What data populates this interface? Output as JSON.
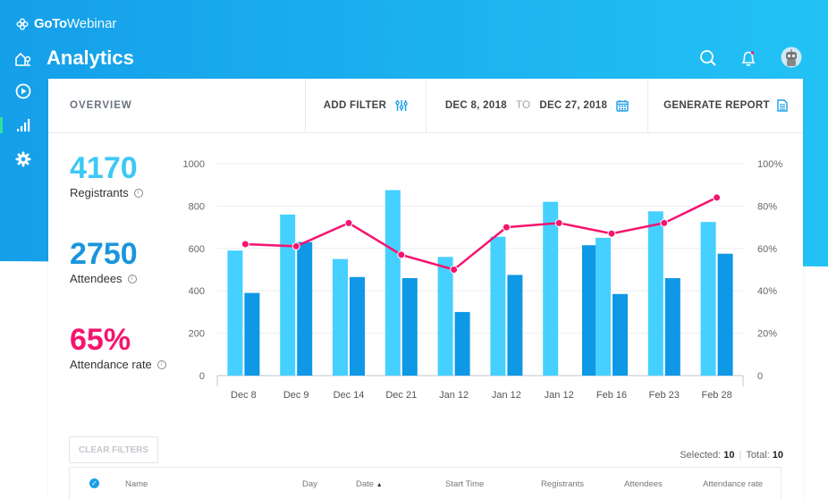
{
  "app": {
    "brand_bold": "GoTo",
    "brand_light": "Webinar",
    "page_title": "Analytics"
  },
  "sidebar": {
    "items": [
      {
        "name": "home",
        "icon": "home-icon",
        "active": false
      },
      {
        "name": "webinars",
        "icon": "play-circle-icon",
        "active": false
      },
      {
        "name": "analytics",
        "icon": "bar-signal-icon",
        "active": true
      },
      {
        "name": "settings",
        "icon": "gear-icon",
        "active": false
      }
    ]
  },
  "header_icons": [
    "search-icon",
    "bell-icon",
    "avatar-robot-icon"
  ],
  "toolbar": {
    "overview_label": "OVERVIEW",
    "add_filter_label": "ADD FILTER",
    "date_from": "DEC 8, 2018",
    "date_to_label": "TO",
    "date_to": "DEC 27, 2018",
    "generate_report_label": "GENERATE REPORT"
  },
  "stats": {
    "registrants": {
      "value": "4170",
      "label": "Registrants",
      "color": "#3dc8f7"
    },
    "attendees": {
      "value": "2750",
      "label": "Attendees",
      "color": "#1a95dc"
    },
    "rate": {
      "value": "65%",
      "label": "Attendance rate",
      "color": "#f5146e"
    }
  },
  "colors": {
    "header_blue": "#17a5ee",
    "registrants": "#45d0ff",
    "attendees": "#0e98e5",
    "rate_line": "#f5146e"
  },
  "chart_data": {
    "type": "bar",
    "title": "",
    "xlabel": "",
    "ylabel": "",
    "categories": [
      "Dec 8",
      "Dec 9",
      "Dec 14",
      "Dec 21",
      "Jan 12",
      "Jan 12",
      "Jan 12",
      "Feb 16",
      "Feb 23",
      "Feb 28"
    ],
    "ylim": [
      0,
      1000
    ],
    "y_ticks": [
      "0",
      "200",
      "400",
      "600",
      "800",
      "1000"
    ],
    "y2lim": [
      0,
      100
    ],
    "y2_ticks": [
      "0",
      "20%",
      "40%",
      "60%",
      "80%",
      "100%"
    ],
    "grid": true,
    "series": [
      {
        "name": "Registrants",
        "type": "bar",
        "values": [
          590,
          760,
          550,
          875,
          560,
          655,
          820,
          650,
          775,
          725
        ]
      },
      {
        "name": "Attendees",
        "type": "bar",
        "values": [
          390,
          630,
          465,
          460,
          300,
          475,
          615,
          385,
          460,
          575
        ]
      },
      {
        "name": "Attendance rate",
        "type": "line",
        "axis": "right",
        "values": [
          62,
          61,
          72,
          57,
          50,
          70,
          72,
          67,
          72,
          84
        ]
      }
    ]
  },
  "table": {
    "clear_filters_label": "CLEAR FILTERS",
    "selected_label": "Selected:",
    "selected_value": "10",
    "total_label": "Total:",
    "total_value": "10",
    "columns": [
      "Name",
      "Day",
      "Date",
      "Start Time",
      "Registrants",
      "Attendees",
      "Attendance rate"
    ],
    "sort_indicator": "▲"
  }
}
